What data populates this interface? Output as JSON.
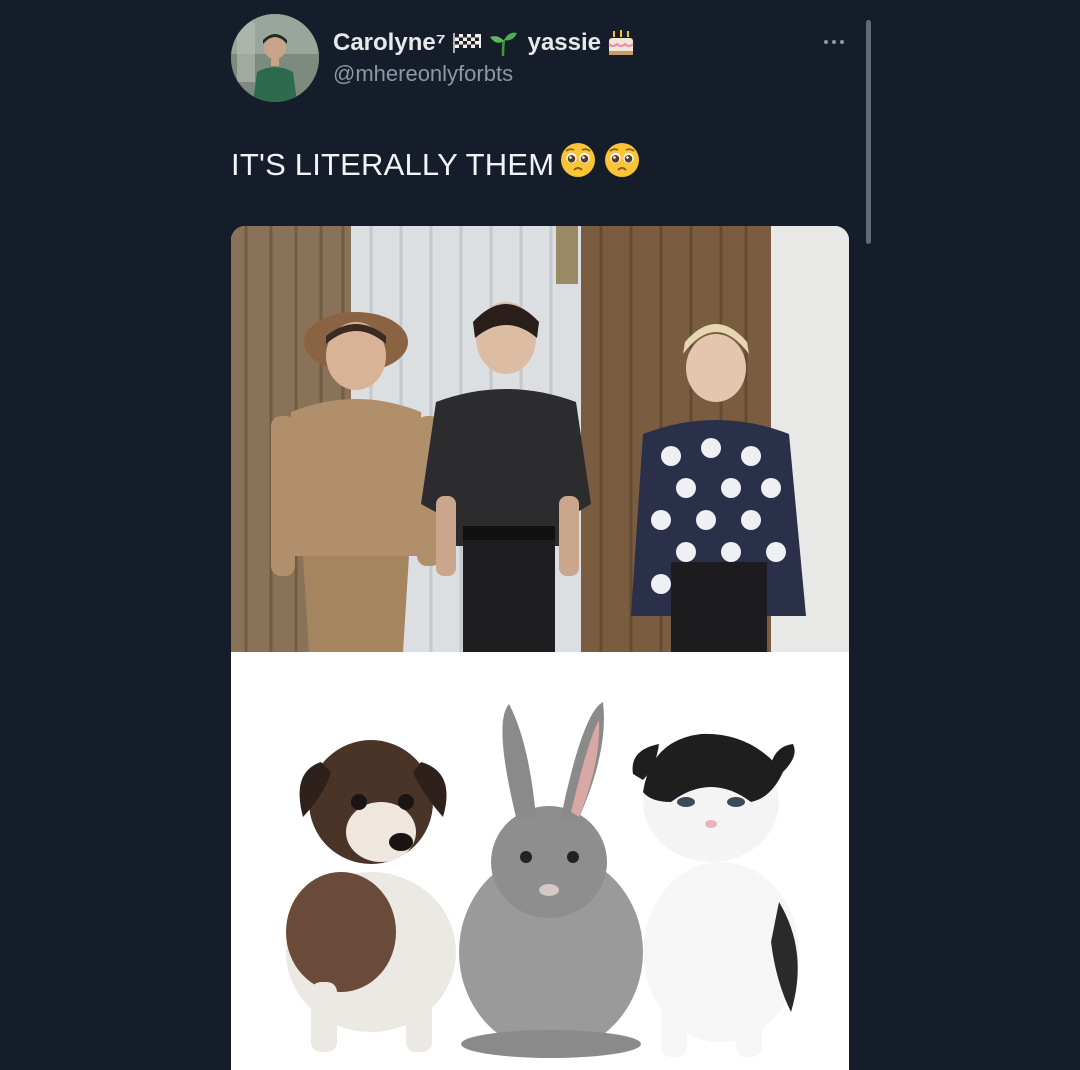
{
  "tweet": {
    "author": {
      "display_name_part1": "Carolyne⁷",
      "display_name_part2": "yassie",
      "emojis": [
        "checkered-flag-icon",
        "seedling-icon",
        "birthday-cake-icon"
      ],
      "handle": "@mhereonlyforbts"
    },
    "text": "IT'S LITERALLY THEM",
    "text_emojis": [
      "pleading-face-icon",
      "pleading-face-icon"
    ],
    "media": [
      {
        "name": "photo-three-people-standing"
      },
      {
        "name": "photo-puppy-bunny-kitten"
      }
    ]
  }
}
